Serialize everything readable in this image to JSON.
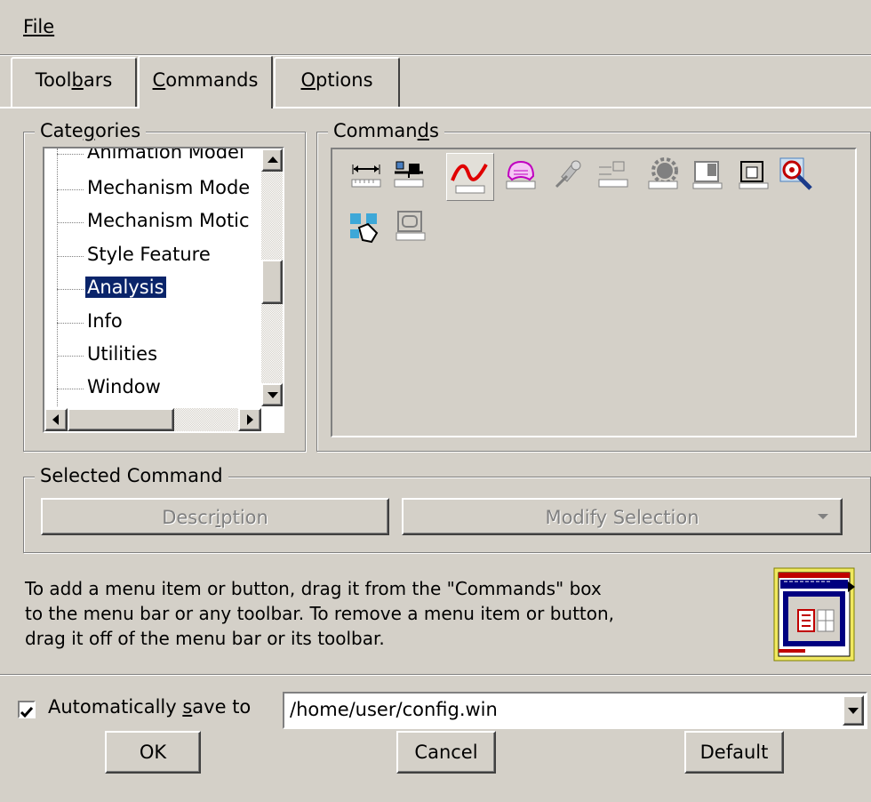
{
  "menu": {
    "file": "File"
  },
  "tabs": [
    {
      "label": "Toolbars"
    },
    {
      "label": "Commands"
    },
    {
      "label": "Options"
    }
  ],
  "categories": {
    "title": "Categories",
    "items": [
      {
        "label": "Animation Model"
      },
      {
        "label": "Mechanism Mode"
      },
      {
        "label": "Mechanism Motic"
      },
      {
        "label": "Style Feature"
      },
      {
        "label": "Analysis",
        "selected": true
      },
      {
        "label": "Info"
      },
      {
        "label": "Utilities"
      },
      {
        "label": "Window"
      }
    ]
  },
  "commands": {
    "title": "Commands",
    "icons": [
      "measure-distance-icon",
      "mass-properties-icon",
      "curve-analysis-icon",
      "surface-analysis-icon",
      "satellite-sensor-icon",
      "compare-parts-icon",
      "gear-analysis-icon",
      "model-analysis-icon",
      "section-analysis-icon",
      "target-icon",
      "hand-select-icon",
      "display-analysis-icon"
    ]
  },
  "selected_command": {
    "title": "Selected Command",
    "description": "Description",
    "modify": "Modify Selection"
  },
  "help": {
    "line1": "To add a menu item or button, drag it from the \"Commands\" box",
    "line2": "to the menu bar or any toolbar.  To remove a menu item or button,",
    "line3": "drag it off of the menu bar or its toolbar."
  },
  "autosave": {
    "checked": true,
    "label": "Automatically save to",
    "path": "/home/user/config.win"
  },
  "buttons": {
    "ok": "OK",
    "cancel": "Cancel",
    "default": "Default"
  }
}
